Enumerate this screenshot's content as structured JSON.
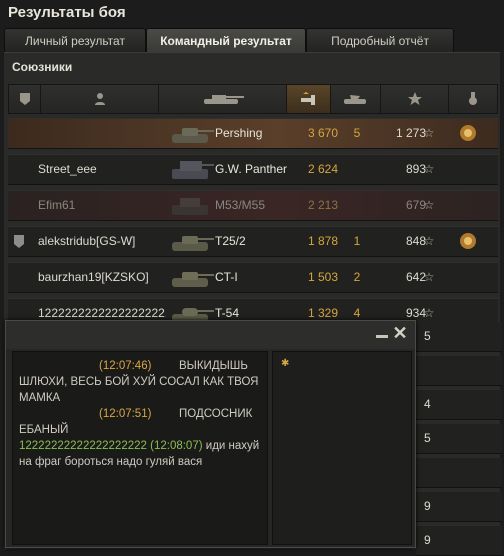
{
  "window": {
    "title": "Результаты боя"
  },
  "tabs": [
    {
      "label": "Личный результат",
      "active": false
    },
    {
      "label": "Командный результат",
      "active": true
    },
    {
      "label": "Подробный отчёт",
      "active": false
    }
  ],
  "section": {
    "label": "Союзники"
  },
  "rows": [
    {
      "player": "",
      "vehicle": "Pershing",
      "damage": "3 670",
      "frags": "5",
      "xp": "1 273",
      "medal": true,
      "clan_icon": false,
      "state": "own"
    },
    {
      "player": "Street_eee",
      "vehicle": "G.W. Panther",
      "damage": "2 624",
      "frags": "",
      "xp": "893",
      "medal": false,
      "clan_icon": false,
      "state": "normal"
    },
    {
      "player": "Efim61",
      "vehicle": "M53/M55",
      "damage": "2 213",
      "frags": "",
      "xp": "679",
      "medal": false,
      "clan_icon": false,
      "state": "dead"
    },
    {
      "player": "alekstridub[GS-W]",
      "vehicle": "T25/2",
      "damage": "1 878",
      "frags": "1",
      "xp": "848",
      "medal": true,
      "clan_icon": true,
      "state": "normal"
    },
    {
      "player": "baurzhan19[KZSKO]",
      "vehicle": "CT-I",
      "damage": "1 503",
      "frags": "2",
      "xp": "642",
      "medal": false,
      "clan_icon": false,
      "state": "normal"
    },
    {
      "player": "1222222222222222222...",
      "vehicle": "T-54",
      "damage": "1 329",
      "frags": "4",
      "xp": "934",
      "medal": false,
      "clan_icon": false,
      "state": "normal"
    }
  ],
  "right_column_partial": [
    "5",
    "",
    "4",
    "5",
    "",
    "9",
    "9"
  ],
  "chat": {
    "messages": [
      {
        "time": "(12:07:46)",
        "nick": "",
        "text": "ВЫКИДЫШЬ ШЛЮХИ, ВЕСЬ БОЙ ХУЙ СОСАЛ КАК ТВОЯ МАМКА"
      },
      {
        "time": "(12:07:51)",
        "nick": "",
        "text": "ПОДСОСНИК ЕБАНЫЙ"
      },
      {
        "time": "(12:08:07)",
        "nick": "12222222222222222222",
        "text": "иди нахуй на фраг бороться надо гуляй вася"
      }
    ]
  },
  "colors": {
    "accent": "#d6a53d",
    "nick": "#8bbf52",
    "own_row": "#5a3f2a"
  }
}
